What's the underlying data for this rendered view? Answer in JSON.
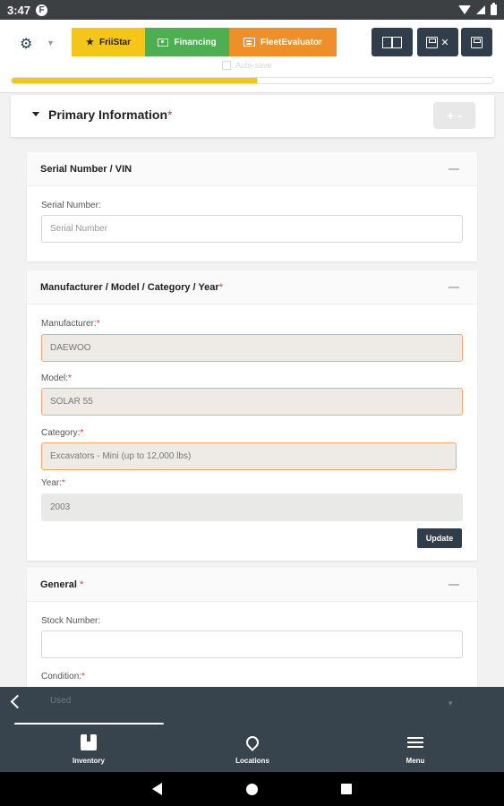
{
  "status_bar": {
    "time": "3:47",
    "notification_icon": "F"
  },
  "toolbar": {
    "frii_label": "FriiStar",
    "financing_label": "Financing",
    "fleet_label": "FleetEvaluator",
    "auto_save_label": "Auto-save",
    "progress_fraction": 0.51
  },
  "primary": {
    "title": "Primary Information",
    "required_mark": "*",
    "plus": "+",
    "minus": "-"
  },
  "serial_card": {
    "title": "Serial Number / VIN",
    "serial_label": "Serial Number:",
    "serial_placeholder": "Serial Number"
  },
  "mmcy_card": {
    "title": "Manufacturer / Model / Category / Year",
    "required_mark": "*",
    "manufacturer_label": "Manufacturer:",
    "manufacturer_value": "DAEWOO",
    "model_label": "Model:",
    "model_value": "SOLAR 55",
    "category_label": "Category:",
    "category_value": "Excavators - Mini (up to 12,000 lbs)",
    "year_label": "Year:",
    "year_value": "2003",
    "update_label": "Update"
  },
  "general_card": {
    "title": "General",
    "required_mark": "*",
    "stock_label": "Stock Number:",
    "stock_value": "",
    "condition_label": "Condition:",
    "condition_hint": "Used"
  },
  "bottom_nav": {
    "inventory_label": "Inventory",
    "locations_label": "Locations",
    "menu_label": "Menu"
  },
  "colors": {
    "accent_yellow": "#f5c518",
    "financing_green": "#4caf50",
    "fleet_orange": "#ef8f2a",
    "dark_slate": "#2f3e4a",
    "required_red": "#e53935"
  }
}
